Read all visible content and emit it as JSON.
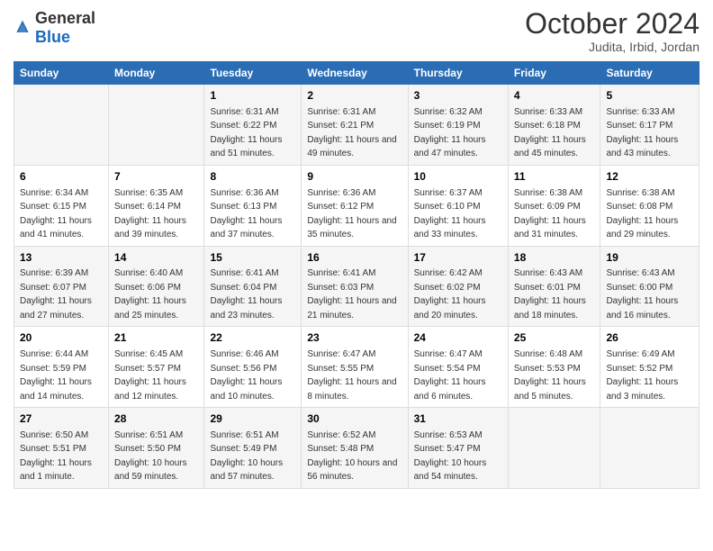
{
  "header": {
    "logo_general": "General",
    "logo_blue": "Blue",
    "month_title": "October 2024",
    "location": "Judita, Irbid, Jordan"
  },
  "weekdays": [
    "Sunday",
    "Monday",
    "Tuesday",
    "Wednesday",
    "Thursday",
    "Friday",
    "Saturday"
  ],
  "weeks": [
    [
      {
        "day": "",
        "sunrise": "",
        "sunset": "",
        "daylight": ""
      },
      {
        "day": "",
        "sunrise": "",
        "sunset": "",
        "daylight": ""
      },
      {
        "day": "1",
        "sunrise": "Sunrise: 6:31 AM",
        "sunset": "Sunset: 6:22 PM",
        "daylight": "Daylight: 11 hours and 51 minutes."
      },
      {
        "day": "2",
        "sunrise": "Sunrise: 6:31 AM",
        "sunset": "Sunset: 6:21 PM",
        "daylight": "Daylight: 11 hours and 49 minutes."
      },
      {
        "day": "3",
        "sunrise": "Sunrise: 6:32 AM",
        "sunset": "Sunset: 6:19 PM",
        "daylight": "Daylight: 11 hours and 47 minutes."
      },
      {
        "day": "4",
        "sunrise": "Sunrise: 6:33 AM",
        "sunset": "Sunset: 6:18 PM",
        "daylight": "Daylight: 11 hours and 45 minutes."
      },
      {
        "day": "5",
        "sunrise": "Sunrise: 6:33 AM",
        "sunset": "Sunset: 6:17 PM",
        "daylight": "Daylight: 11 hours and 43 minutes."
      }
    ],
    [
      {
        "day": "6",
        "sunrise": "Sunrise: 6:34 AM",
        "sunset": "Sunset: 6:15 PM",
        "daylight": "Daylight: 11 hours and 41 minutes."
      },
      {
        "day": "7",
        "sunrise": "Sunrise: 6:35 AM",
        "sunset": "Sunset: 6:14 PM",
        "daylight": "Daylight: 11 hours and 39 minutes."
      },
      {
        "day": "8",
        "sunrise": "Sunrise: 6:36 AM",
        "sunset": "Sunset: 6:13 PM",
        "daylight": "Daylight: 11 hours and 37 minutes."
      },
      {
        "day": "9",
        "sunrise": "Sunrise: 6:36 AM",
        "sunset": "Sunset: 6:12 PM",
        "daylight": "Daylight: 11 hours and 35 minutes."
      },
      {
        "day": "10",
        "sunrise": "Sunrise: 6:37 AM",
        "sunset": "Sunset: 6:10 PM",
        "daylight": "Daylight: 11 hours and 33 minutes."
      },
      {
        "day": "11",
        "sunrise": "Sunrise: 6:38 AM",
        "sunset": "Sunset: 6:09 PM",
        "daylight": "Daylight: 11 hours and 31 minutes."
      },
      {
        "day": "12",
        "sunrise": "Sunrise: 6:38 AM",
        "sunset": "Sunset: 6:08 PM",
        "daylight": "Daylight: 11 hours and 29 minutes."
      }
    ],
    [
      {
        "day": "13",
        "sunrise": "Sunrise: 6:39 AM",
        "sunset": "Sunset: 6:07 PM",
        "daylight": "Daylight: 11 hours and 27 minutes."
      },
      {
        "day": "14",
        "sunrise": "Sunrise: 6:40 AM",
        "sunset": "Sunset: 6:06 PM",
        "daylight": "Daylight: 11 hours and 25 minutes."
      },
      {
        "day": "15",
        "sunrise": "Sunrise: 6:41 AM",
        "sunset": "Sunset: 6:04 PM",
        "daylight": "Daylight: 11 hours and 23 minutes."
      },
      {
        "day": "16",
        "sunrise": "Sunrise: 6:41 AM",
        "sunset": "Sunset: 6:03 PM",
        "daylight": "Daylight: 11 hours and 21 minutes."
      },
      {
        "day": "17",
        "sunrise": "Sunrise: 6:42 AM",
        "sunset": "Sunset: 6:02 PM",
        "daylight": "Daylight: 11 hours and 20 minutes."
      },
      {
        "day": "18",
        "sunrise": "Sunrise: 6:43 AM",
        "sunset": "Sunset: 6:01 PM",
        "daylight": "Daylight: 11 hours and 18 minutes."
      },
      {
        "day": "19",
        "sunrise": "Sunrise: 6:43 AM",
        "sunset": "Sunset: 6:00 PM",
        "daylight": "Daylight: 11 hours and 16 minutes."
      }
    ],
    [
      {
        "day": "20",
        "sunrise": "Sunrise: 6:44 AM",
        "sunset": "Sunset: 5:59 PM",
        "daylight": "Daylight: 11 hours and 14 minutes."
      },
      {
        "day": "21",
        "sunrise": "Sunrise: 6:45 AM",
        "sunset": "Sunset: 5:57 PM",
        "daylight": "Daylight: 11 hours and 12 minutes."
      },
      {
        "day": "22",
        "sunrise": "Sunrise: 6:46 AM",
        "sunset": "Sunset: 5:56 PM",
        "daylight": "Daylight: 11 hours and 10 minutes."
      },
      {
        "day": "23",
        "sunrise": "Sunrise: 6:47 AM",
        "sunset": "Sunset: 5:55 PM",
        "daylight": "Daylight: 11 hours and 8 minutes."
      },
      {
        "day": "24",
        "sunrise": "Sunrise: 6:47 AM",
        "sunset": "Sunset: 5:54 PM",
        "daylight": "Daylight: 11 hours and 6 minutes."
      },
      {
        "day": "25",
        "sunrise": "Sunrise: 6:48 AM",
        "sunset": "Sunset: 5:53 PM",
        "daylight": "Daylight: 11 hours and 5 minutes."
      },
      {
        "day": "26",
        "sunrise": "Sunrise: 6:49 AM",
        "sunset": "Sunset: 5:52 PM",
        "daylight": "Daylight: 11 hours and 3 minutes."
      }
    ],
    [
      {
        "day": "27",
        "sunrise": "Sunrise: 6:50 AM",
        "sunset": "Sunset: 5:51 PM",
        "daylight": "Daylight: 11 hours and 1 minute."
      },
      {
        "day": "28",
        "sunrise": "Sunrise: 6:51 AM",
        "sunset": "Sunset: 5:50 PM",
        "daylight": "Daylight: 10 hours and 59 minutes."
      },
      {
        "day": "29",
        "sunrise": "Sunrise: 6:51 AM",
        "sunset": "Sunset: 5:49 PM",
        "daylight": "Daylight: 10 hours and 57 minutes."
      },
      {
        "day": "30",
        "sunrise": "Sunrise: 6:52 AM",
        "sunset": "Sunset: 5:48 PM",
        "daylight": "Daylight: 10 hours and 56 minutes."
      },
      {
        "day": "31",
        "sunrise": "Sunrise: 6:53 AM",
        "sunset": "Sunset: 5:47 PM",
        "daylight": "Daylight: 10 hours and 54 minutes."
      },
      {
        "day": "",
        "sunrise": "",
        "sunset": "",
        "daylight": ""
      },
      {
        "day": "",
        "sunrise": "",
        "sunset": "",
        "daylight": ""
      }
    ]
  ]
}
